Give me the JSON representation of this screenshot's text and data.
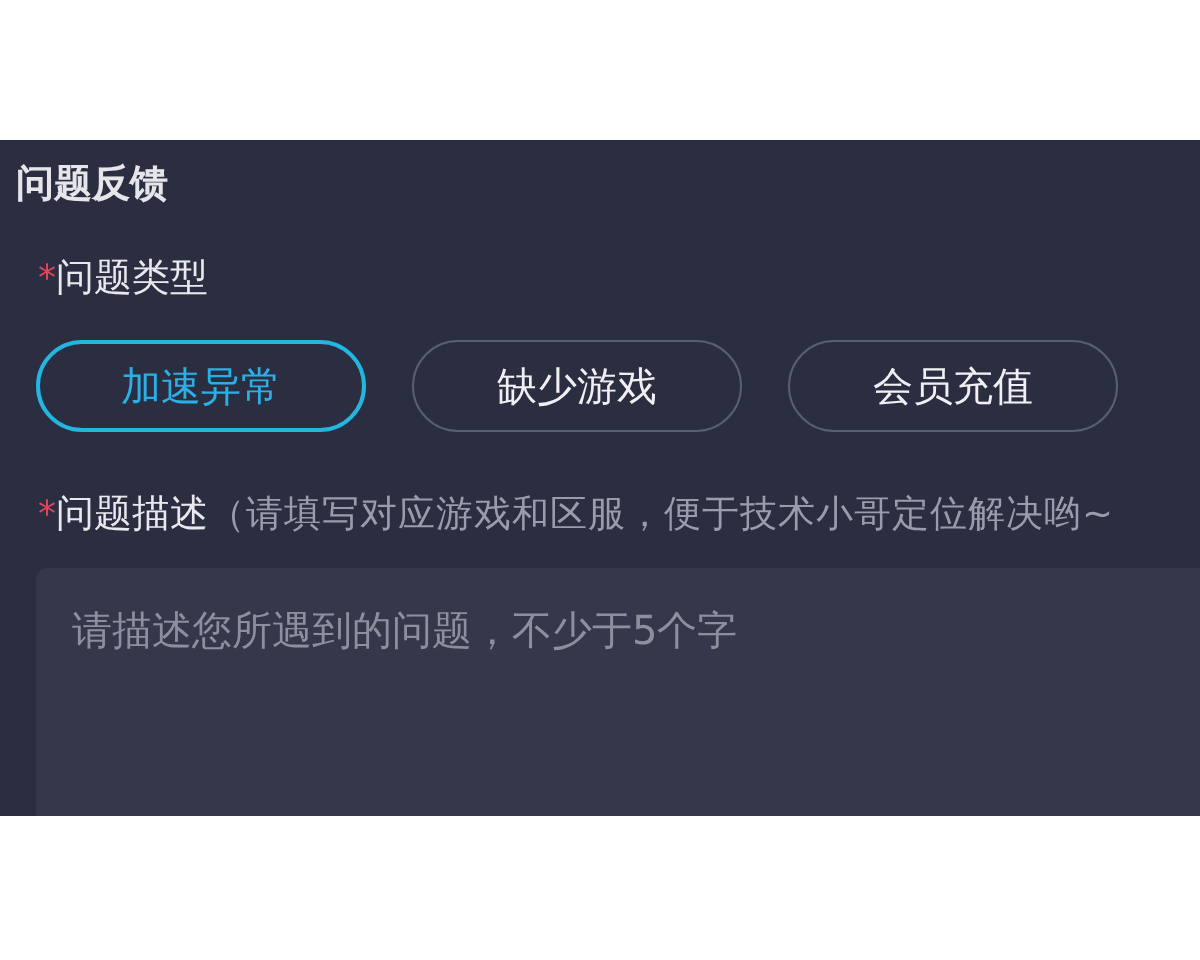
{
  "panel": {
    "title": "问题反馈"
  },
  "type_field": {
    "required_mark": "*",
    "label": "问题类型",
    "options": [
      {
        "label": "加速异常",
        "selected": true
      },
      {
        "label": "缺少游戏",
        "selected": false
      },
      {
        "label": "会员充值",
        "selected": false
      }
    ]
  },
  "description_field": {
    "required_mark": "*",
    "label": "问题描述",
    "hint": "（请填写对应游戏和区服，便于技术小哥定位解决哟~",
    "placeholder": "请描述您所遇到的问题，不少于5个字"
  }
}
